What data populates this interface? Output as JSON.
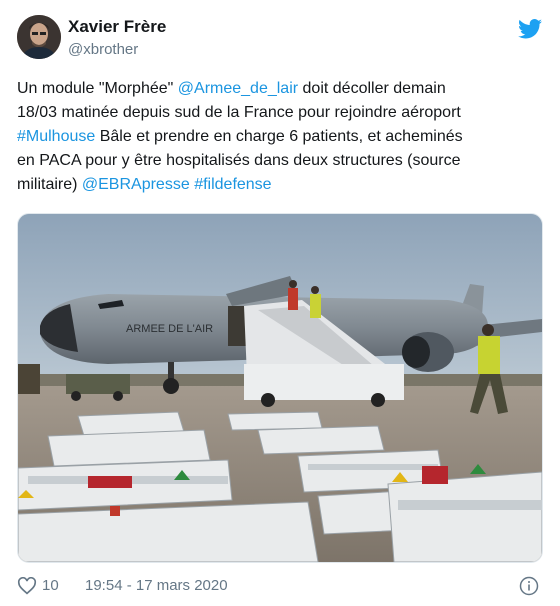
{
  "tweet": {
    "author_name": "Xavier Frère",
    "author_handle": "@xbrother",
    "text_lines": [
      [
        {
          "t": "Un module \"Morphée\" ",
          "link": false
        },
        {
          "t": "@Armee_de_lair",
          "link": true
        },
        {
          "t": " doit décoller demain",
          "link": false
        }
      ],
      [
        {
          "t": "18/03 matinée depuis sud de la France pour rejoindre aéroport",
          "link": false
        }
      ],
      [
        {
          "t": "#Mulhouse",
          "link": true
        },
        {
          "t": " Bâle et prendre en charge 6 patients, et acheminés",
          "link": false
        }
      ],
      [
        {
          "t": "en PACA pour y être hospitalisés dans deux structures (source",
          "link": false
        }
      ],
      [
        {
          "t": "militaire) ",
          "link": false
        },
        {
          "t": "@EBRApresse",
          "link": true
        },
        {
          "t": " ",
          "link": false
        },
        {
          "t": "#fildefense",
          "link": true
        }
      ]
    ],
    "photo": {
      "aircraft_marking": "ARMEE DE L'AIR"
    },
    "likes": "10",
    "timestamp": "19:54 - 17 mars 2020"
  },
  "colors": {
    "link": "#1b95e0",
    "secondary_text": "#657786",
    "twitter_blue": "#1da1f2"
  }
}
